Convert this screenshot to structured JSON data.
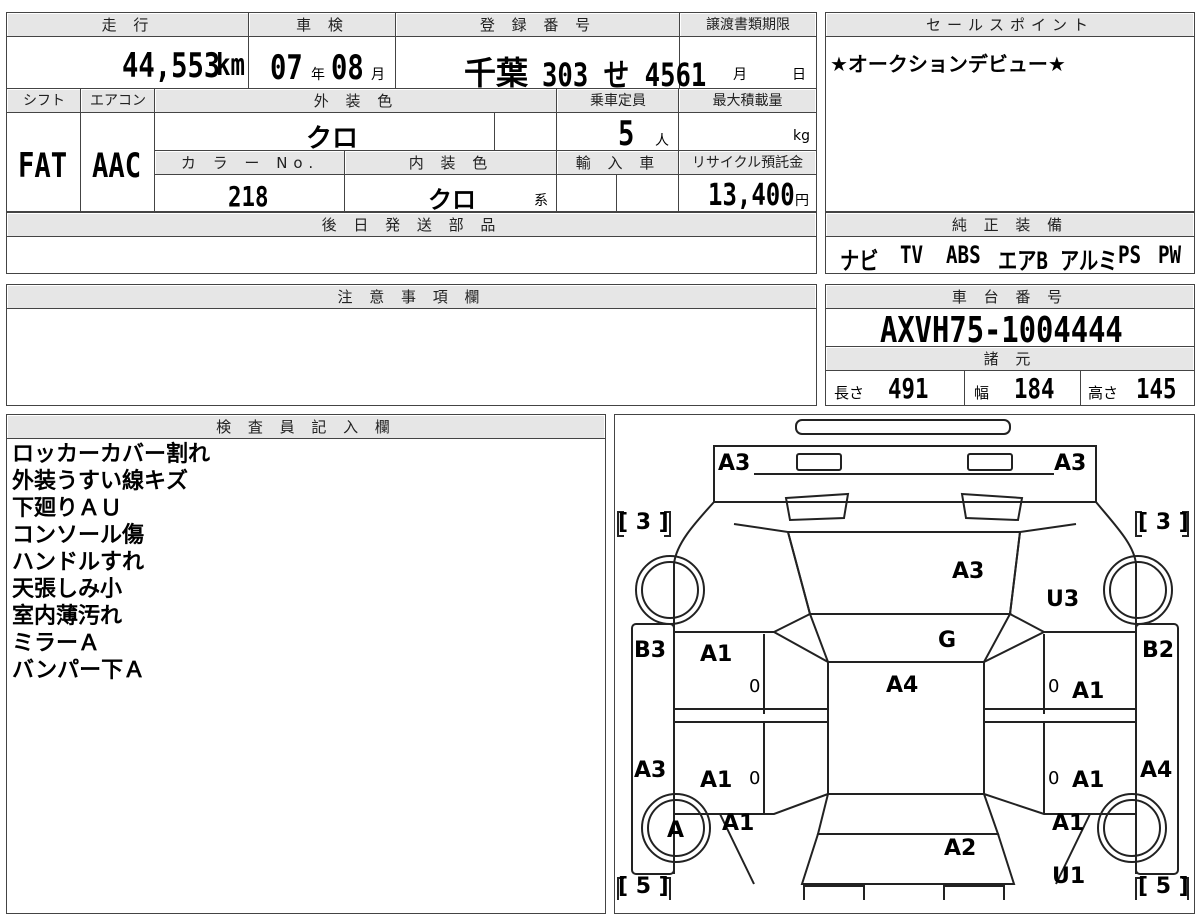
{
  "mileage": {
    "header": "走 行",
    "value": "44,553",
    "unit": "km"
  },
  "shaken": {
    "header": "車 検",
    "year": "07",
    "year_unit": "年",
    "month": "08",
    "month_unit": "月"
  },
  "registration": {
    "header": "登 録 番 号",
    "area": "千葉",
    "number": "303 せ 4561"
  },
  "transfer_deadline": {
    "header": "譲渡書類期限",
    "month_unit": "月",
    "day_unit": "日"
  },
  "sales_point": {
    "header": "セールスポイント",
    "text": "★オークションデビュー★"
  },
  "shift": {
    "header": "シフト",
    "value": "FAT"
  },
  "aircon": {
    "header": "エアコン",
    "value": "AAC"
  },
  "exterior_color": {
    "header": "外 装 色",
    "value": "クロ"
  },
  "capacity": {
    "header": "乗車定員",
    "value": "5",
    "unit": "人"
  },
  "max_load": {
    "header": "最大積載量",
    "unit": "kg"
  },
  "color_no": {
    "header": "カ ラ ー No.",
    "value": "218"
  },
  "interior_color": {
    "header": "内 装 色",
    "value": "クロ",
    "suffix": "系"
  },
  "import": {
    "header": "輸 入 車"
  },
  "recycle": {
    "header": "リサイクル預託金",
    "value": "13,400",
    "unit": "円"
  },
  "later_parts": {
    "header": "後 日 発 送 部 品"
  },
  "genuine_equipment": {
    "header": "純 正 装 備",
    "items": [
      "ナビ",
      "TV",
      "ABS",
      "エアB",
      "アルミ",
      "PS",
      "PW"
    ]
  },
  "caution": {
    "header": "注 意 事 項 欄"
  },
  "chassis": {
    "header": "車 台 番 号",
    "value": "AXVH75-1004444"
  },
  "specs": {
    "header": "諸 元",
    "length": {
      "label": "長さ",
      "value": "491"
    },
    "width": {
      "label": "幅",
      "value": "184"
    },
    "height": {
      "label": "高さ",
      "value": "145"
    }
  },
  "inspector": {
    "header": "検 査 員 記 入 欄",
    "notes": [
      "ロッカーカバー割れ",
      "外装うすい線キズ",
      "下廻りＡＵ",
      "コンソール傷",
      "ハンドルすれ",
      "天張しみ小",
      "室内薄汚れ",
      "ミラーＡ",
      "バンパー下Ａ"
    ]
  },
  "diagram": {
    "front_left": "A3",
    "front_right": "A3",
    "tire_fl": "[ 3 ]",
    "tire_fr": "[ 3 ]",
    "tire_rl": "[ 5 ]",
    "tire_rr": "[ 5 ]",
    "hood": "A3",
    "fender_front_right": "U3",
    "windshield": "G",
    "left_front_side": "B3",
    "right_front_side": "B2",
    "front_door_left": "A1",
    "roof": "A4",
    "front_door_right": "A1",
    "rear_left_side": "A3",
    "rear_door_left": "A1",
    "rear_door_right": "A1",
    "rear_right_side": "A4",
    "wheel_rl": "A",
    "rear_quarter_left": "A1",
    "rear_quarter_right": "A1",
    "trunk": "A2",
    "rear_bumper_right": "U1",
    "mirror_left": "0",
    "mirror_right": "0",
    "mirror_left_rear": "0",
    "mirror_right_rear": "0"
  }
}
